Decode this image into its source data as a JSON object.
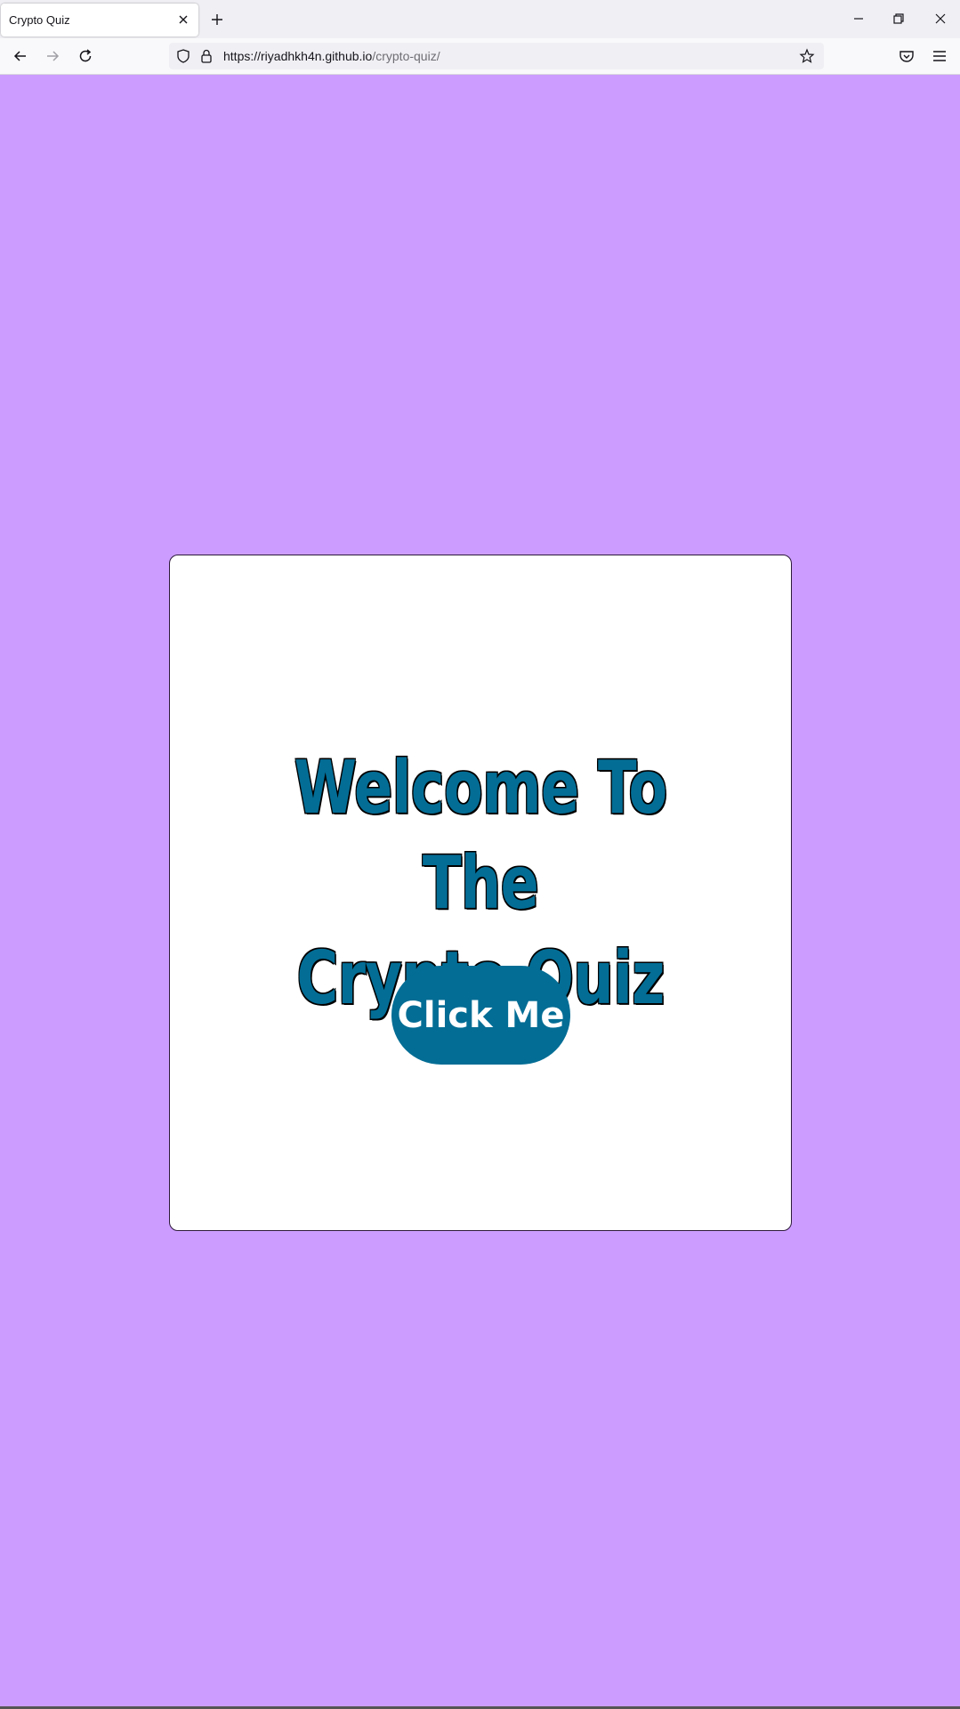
{
  "browser": {
    "tab_title": "Crypto Quiz",
    "url_host": "https://riyadhkh4n.github.io",
    "url_path": "/crypto-quiz/"
  },
  "page": {
    "heading_line1": "Welcome To The",
    "heading_line2": "Crypto Quiz",
    "button_label": "Click Me"
  },
  "colors": {
    "background": "#cc9dff",
    "card": "#ffffff",
    "accent": "#036d95"
  },
  "icons": [
    "close-icon",
    "plus-icon",
    "minimize-icon",
    "restore-icon",
    "window-close-icon",
    "back-arrow-icon",
    "forward-arrow-icon",
    "reload-icon",
    "shield-icon",
    "lock-icon",
    "star-icon",
    "pocket-icon",
    "menu-icon"
  ]
}
